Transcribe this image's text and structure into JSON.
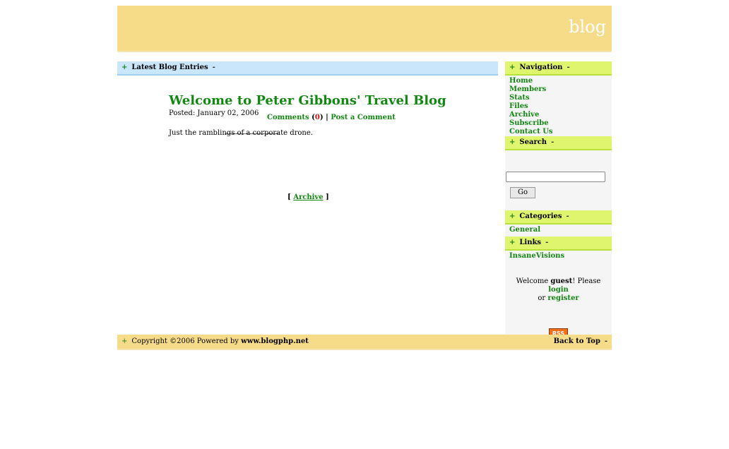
{
  "header": {
    "site_title": "blog"
  },
  "main": {
    "section_title": "Latest Blog Entries",
    "plus": "+",
    "minus": "-",
    "entry": {
      "title": "Welcome to Peter Gibbons' Travel Blog",
      "posted": "Posted: January 02, 2006",
      "body": "Just the ramblings of a corporate drone.",
      "comments_label": "Comments",
      "comments_count": "0",
      "post_comment_label": "Post a Comment",
      "divider": "------------------------------"
    },
    "archive_label": "Archive"
  },
  "sidebar": {
    "navigation_title": "Navigation",
    "nav_items": [
      "Home",
      "Members",
      "Stats",
      "Files",
      "Archive",
      "Subscribe",
      "Contact Us"
    ],
    "search_title": "Search",
    "search_value": "",
    "go_label": "Go",
    "categories_title": "Categories",
    "categories": [
      "General"
    ],
    "links_title": "Links",
    "links": [
      "InsaneVisions"
    ],
    "welcome_prefix": "Welcome",
    "welcome_user": "guest",
    "welcome_please": "! Please",
    "login_label": "login",
    "or_text": "or",
    "register_label": "register",
    "rss_label": "RSS"
  },
  "footer": {
    "copyright": "Copyright ©2006 Powered by",
    "powered_by": "www.blogphp.net",
    "back_to_top": "Back to Top"
  },
  "colors": {
    "header_bg": "#f6dc88",
    "blue_bar": "#c9e6fa",
    "green_bar": "#dff56d",
    "link_green": "#128712",
    "count_red": "#d01010"
  }
}
